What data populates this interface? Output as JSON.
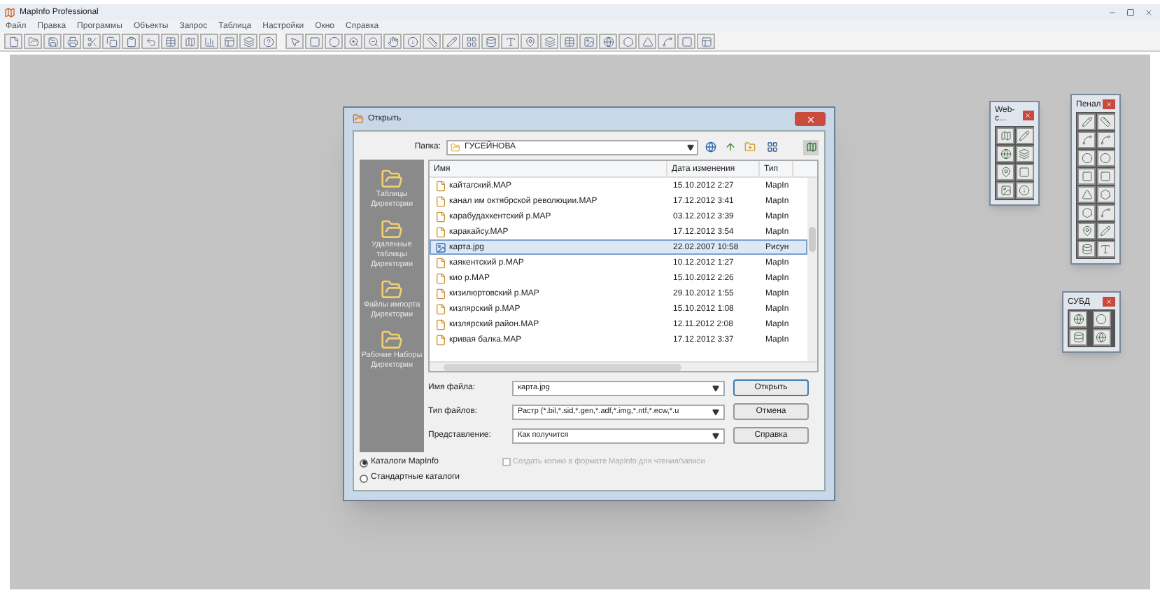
{
  "window": {
    "title": "MapInfo Professional"
  },
  "menu": [
    "Файл",
    "Правка",
    "Программы",
    "Объекты",
    "Запрос",
    "Таблица",
    "Настройки",
    "Окно",
    "Справка"
  ],
  "dialog": {
    "title": "Открыть",
    "folder_label": "Папка:",
    "folder": "ГУСЕЙНОВА",
    "places": [
      {
        "label": "Таблицы Директории",
        "selected": false
      },
      {
        "label": "Удаленные таблицы Директории",
        "selected": false
      },
      {
        "label": "Файлы импорта Директории",
        "selected": false
      },
      {
        "label": "Рабочие Наборы Директории",
        "selected": false
      }
    ],
    "columns": [
      "Имя",
      "Дата изменения",
      "Тип"
    ],
    "rows": [
      {
        "kind": "map",
        "name": "кайтагский.MAP",
        "date": "15.10.2012 2:27",
        "type": "MapIn",
        "selected": false
      },
      {
        "kind": "map",
        "name": "канал им октябрской революции.MAP",
        "date": "17.12.2012 3:41",
        "type": "MapIn",
        "selected": false
      },
      {
        "kind": "map",
        "name": "карабудахкентский р.MAP",
        "date": "03.12.2012 3:39",
        "type": "MapIn",
        "selected": false
      },
      {
        "kind": "map",
        "name": "каракайсу.MAP",
        "date": "17.12.2012 3:54",
        "type": "MapIn",
        "selected": false
      },
      {
        "kind": "image",
        "name": "карта.jpg",
        "date": "22.02.2007 10:58",
        "type": "Рисун",
        "selected": true
      },
      {
        "kind": "map",
        "name": "каякентский р.MAP",
        "date": "10.12.2012 1:27",
        "type": "MapIn",
        "selected": false
      },
      {
        "kind": "map",
        "name": "кио р.MAP",
        "date": "15.10.2012 2:26",
        "type": "MapIn",
        "selected": false
      },
      {
        "kind": "map",
        "name": "кизилюртовский р.MAP",
        "date": "29.10.2012 1:55",
        "type": "MapIn",
        "selected": false
      },
      {
        "kind": "map",
        "name": "кизлярский р.MAP",
        "date": "15.10.2012 1:08",
        "type": "MapIn",
        "selected": false
      },
      {
        "kind": "map",
        "name": "кизлярский район.MAP",
        "date": "12.11.2012 2:08",
        "type": "MapIn",
        "selected": false
      },
      {
        "kind": "map",
        "name": "кривая балка.MAP",
        "date": "17.12.2012 3:37",
        "type": "MapIn",
        "selected": false
      }
    ],
    "fields": [
      {
        "label": "Имя файла:",
        "value": "карта.jpg"
      },
      {
        "label": "Тип файлов:",
        "value": "Растр (*.bil,*.sid,*.gen,*.adf,*.img,*.ntf,*.ecw,*.u"
      },
      {
        "label": "Представление:",
        "value": "Как получится"
      }
    ],
    "buttons": [
      {
        "label": "Открыть",
        "default": true
      },
      {
        "label": "Отмена",
        "default": false
      },
      {
        "label": "Справка",
        "default": false
      }
    ],
    "copy_checkbox": {
      "label": "Создать копию в формате MapInfo для чтения/записи",
      "checked": false,
      "disabled": true
    },
    "catalogs": [
      {
        "label": "Каталоги MapInfo",
        "selected": true
      },
      {
        "label": "Стандартные каталоги",
        "selected": false
      }
    ]
  },
  "palettes": [
    {
      "title": "Web-c..."
    },
    {
      "title": "Пенал"
    },
    {
      "title": "СУБД"
    }
  ]
}
